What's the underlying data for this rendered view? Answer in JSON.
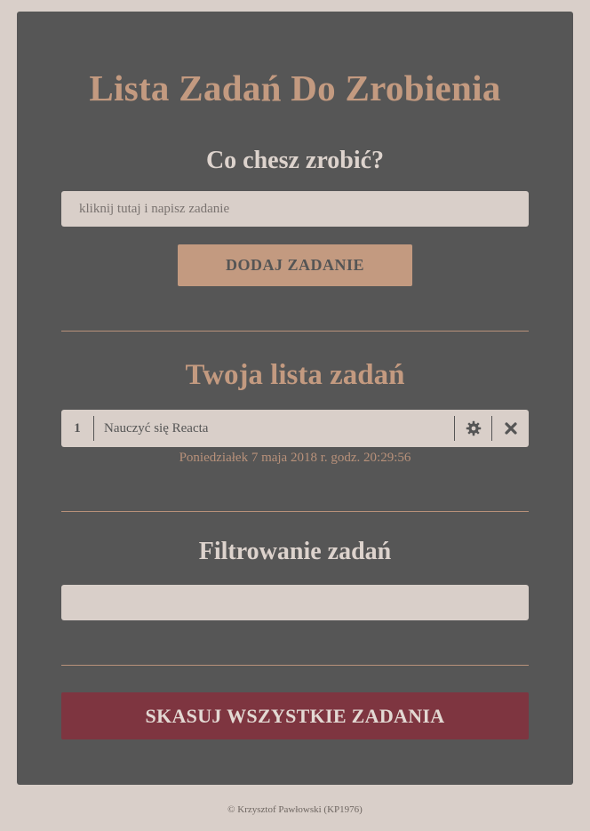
{
  "app": {
    "title": "Lista Zadań Do Zrobienia"
  },
  "add_task": {
    "heading": "Co chesz zrobić?",
    "placeholder": "kliknij tutaj i napisz zadanie",
    "value": "",
    "button_label": "DODAJ ZADANIE"
  },
  "task_list": {
    "heading": "Twoja lista zadań",
    "items": [
      {
        "number": "1",
        "text": "Nauczyć się Reacta",
        "date": "Poniedziałek 7 maja 2018 r. godz. 20:29:56",
        "edit_icon": "gear-icon",
        "delete_icon": "close-icon"
      }
    ]
  },
  "filter": {
    "heading": "Filtrowanie zadań",
    "value": ""
  },
  "delete_all": {
    "button_label": "SKASUJ WSZYSTKIE ZADANIA"
  },
  "footer": {
    "text": "© Krzysztof Pawłowski (KP1976)"
  },
  "colors": {
    "page_bg": "#d9cfc9",
    "card_bg": "#565656",
    "accent": "#c39a80",
    "danger": "#7e3540"
  }
}
